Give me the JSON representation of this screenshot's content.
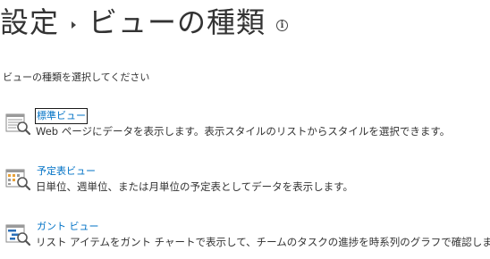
{
  "header": {
    "breadcrumb_root": "設定",
    "page_title": "ビューの種類"
  },
  "instruction": "ビューの種類を選択してください",
  "views": [
    {
      "label": "標準ビュー",
      "description": "Web ページにデータを表示します。表示スタイルのリストからスタイルを選択できます。",
      "icon": "standard-view-icon"
    },
    {
      "label": "予定表ビュー",
      "description": "日単位、週単位、または月単位の予定表としてデータを表示します。",
      "icon": "calendar-view-icon"
    },
    {
      "label": "ガント ビュー",
      "description": "リスト アイテムをガント チャートで表示して、チームのタスクの進捗を時系列のグラフで確認します。",
      "icon": "gantt-view-icon"
    }
  ],
  "colors": {
    "link": "#0072c6",
    "icon_gray": "#7a7a7a",
    "icon_blue": "#2a6fb8",
    "icon_orange": "#e8a23a"
  }
}
